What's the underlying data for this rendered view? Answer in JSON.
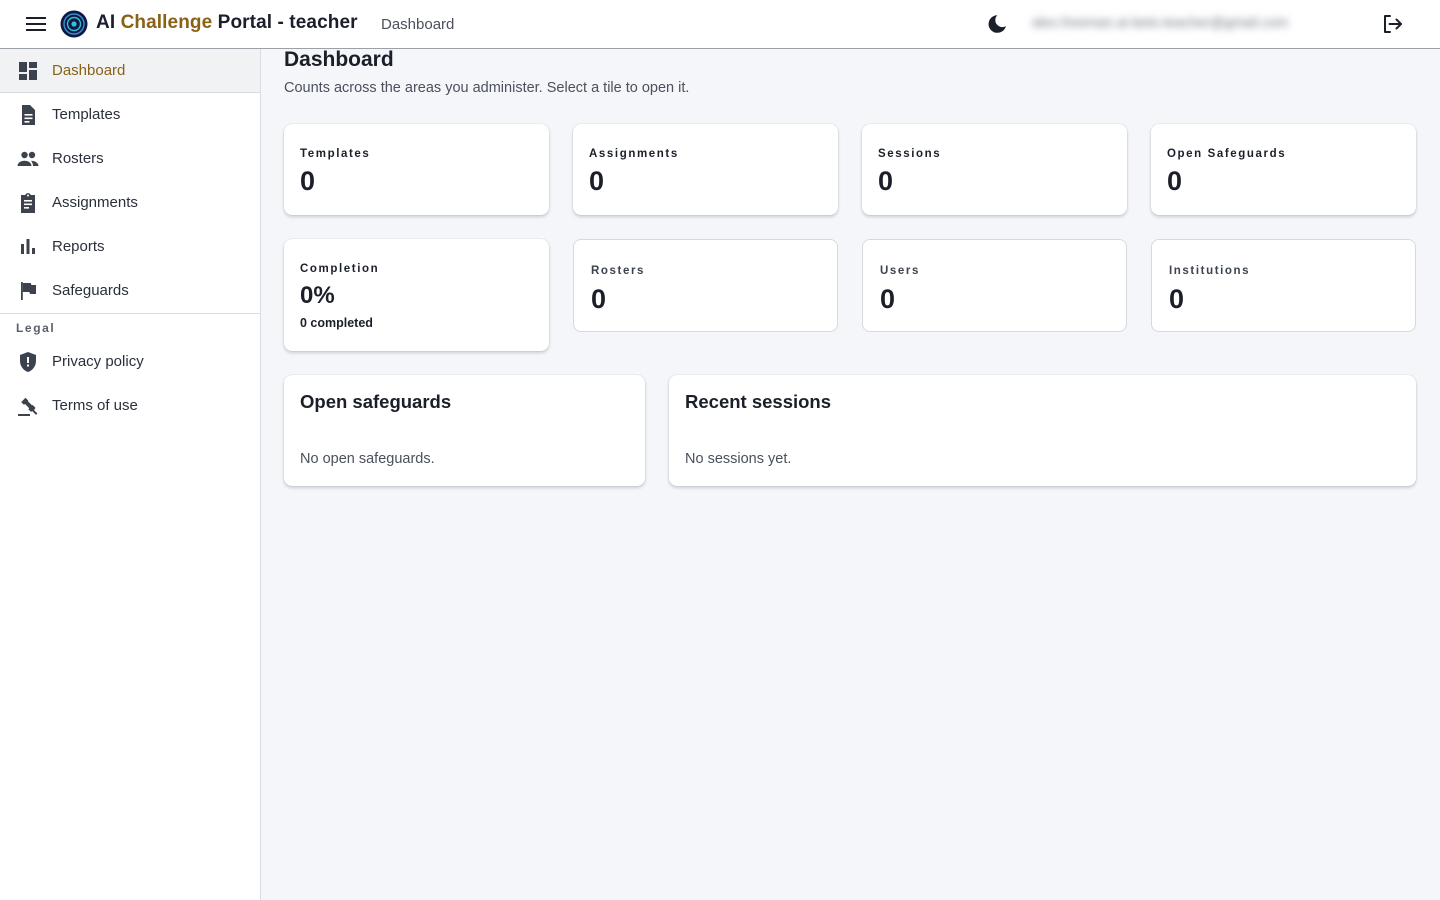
{
  "header": {
    "title_prefix": "AI ",
    "title_accent": "Challenge",
    "title_suffix": " Portal - teacher",
    "breadcrumb": "Dashboard",
    "user_email": "alex.freeman.ai-bets-teacher@gmail.com"
  },
  "sidebar": {
    "items": [
      {
        "label": "Dashboard",
        "icon": "dashboard-icon",
        "active": true
      },
      {
        "label": "Templates",
        "icon": "document-icon"
      },
      {
        "label": "Rosters",
        "icon": "people-icon"
      },
      {
        "label": "Assignments",
        "icon": "clipboard-icon"
      },
      {
        "label": "Reports",
        "icon": "bar-chart-icon"
      },
      {
        "label": "Safeguards",
        "icon": "flag-icon"
      }
    ],
    "legal_label": "Legal",
    "legal_items": [
      {
        "label": "Privacy policy",
        "icon": "shield-icon"
      },
      {
        "label": "Terms of use",
        "icon": "gavel-icon"
      }
    ]
  },
  "main": {
    "title": "Dashboard",
    "subtitle": "Counts across the areas you administer. Select a tile to open it.",
    "tiles_row1": [
      {
        "label": "Templates",
        "value": "0"
      },
      {
        "label": "Assignments",
        "value": "0"
      },
      {
        "label": "Sessions",
        "value": "0"
      },
      {
        "label": "Open Safeguards",
        "value": "0"
      }
    ],
    "completion": {
      "label": "Completion",
      "value": "0%",
      "sub": "0 completed"
    },
    "tiles_row2": [
      {
        "label": "Rosters",
        "value": "0"
      },
      {
        "label": "Users",
        "value": "0"
      },
      {
        "label": "Institutions",
        "value": "0"
      }
    ],
    "panels": {
      "safeguards": {
        "title": "Open safeguards",
        "empty": "No open safeguards."
      },
      "sessions": {
        "title": "Recent sessions",
        "empty": "No sessions yet."
      }
    }
  },
  "colors": {
    "accent": "#8a6216",
    "background": "#f4f6fa",
    "text": "#1b1f2a"
  }
}
